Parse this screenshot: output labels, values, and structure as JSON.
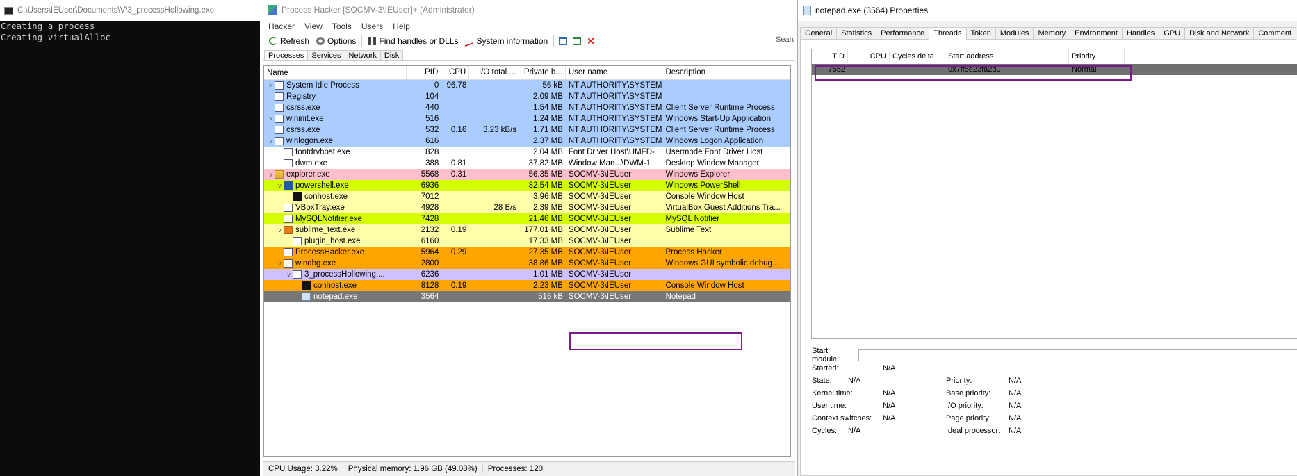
{
  "console": {
    "title": "C:\\Users\\IEUser\\Documents\\V\\3_processHollowing.exe",
    "lines": [
      "Creating a process",
      "Creating virtualAlloc"
    ]
  },
  "process_hacker": {
    "title": "Process Hacker [SOCMV-3\\IEUser]+ (Administrator)",
    "menu": [
      "Hacker",
      "View",
      "Tools",
      "Users",
      "Help"
    ],
    "toolbar": {
      "refresh": "Refresh",
      "options": "Options",
      "find_handles": "Find handles or DLLs",
      "system_info": "System information",
      "search_placeholder": "Search"
    },
    "tabs": [
      "Processes",
      "Services",
      "Network",
      "Disk"
    ],
    "columns": [
      "Name",
      "PID",
      "CPU",
      "I/O total ...",
      "Private b...",
      "User name",
      "Description"
    ],
    "processes": [
      {
        "indent": 0,
        "exp": ">",
        "icon": "window-icon",
        "name": "System Idle Process",
        "pid": "0",
        "cpu": "96.78",
        "io": "",
        "priv": "56 kB",
        "user": "NT AUTHORITY\\SYSTEM",
        "desc": "",
        "bg": "#aaccff"
      },
      {
        "indent": 0,
        "exp": "",
        "icon": "window-icon",
        "name": "Registry",
        "pid": "104",
        "cpu": "",
        "io": "",
        "priv": "2.09 MB",
        "user": "NT AUTHORITY\\SYSTEM",
        "desc": "",
        "bg": "#aaccff"
      },
      {
        "indent": 0,
        "exp": "",
        "icon": "window-icon",
        "name": "csrss.exe",
        "pid": "440",
        "cpu": "",
        "io": "",
        "priv": "1.54 MB",
        "user": "NT AUTHORITY\\SYSTEM",
        "desc": "Client Server Runtime Process",
        "bg": "#aaccff"
      },
      {
        "indent": 0,
        "exp": ">",
        "icon": "window-icon",
        "name": "wininit.exe",
        "pid": "516",
        "cpu": "",
        "io": "",
        "priv": "1.24 MB",
        "user": "NT AUTHORITY\\SYSTEM",
        "desc": "Windows Start-Up Application",
        "bg": "#aaccff"
      },
      {
        "indent": 0,
        "exp": "",
        "icon": "window-icon",
        "name": "csrss.exe",
        "pid": "532",
        "cpu": "0.16",
        "io": "3.23 kB/s",
        "priv": "1.71 MB",
        "user": "NT AUTHORITY\\SYSTEM",
        "desc": "Client Server Runtime Process",
        "bg": "#aaccff"
      },
      {
        "indent": 0,
        "exp": "v",
        "icon": "window-icon",
        "name": "winlogon.exe",
        "pid": "616",
        "cpu": "",
        "io": "",
        "priv": "2.37 MB",
        "user": "NT AUTHORITY\\SYSTEM",
        "desc": "Windows Logon Application",
        "bg": "#aaccff"
      },
      {
        "indent": 1,
        "exp": "",
        "icon": "window-icon",
        "name": "fontdrvhost.exe",
        "pid": "828",
        "cpu": "",
        "io": "",
        "priv": "2.04 MB",
        "user": "Font Driver Host\\UMFD-",
        "desc": "Usermode Font Driver Host",
        "bg": "#ffffff"
      },
      {
        "indent": 1,
        "exp": "",
        "icon": "window-icon",
        "name": "dwm.exe",
        "pid": "388",
        "cpu": "0.81",
        "io": "",
        "priv": "37.82 MB",
        "user": "Window Man...\\DWM-1",
        "desc": "Desktop Window Manager",
        "bg": "#ffffff"
      },
      {
        "indent": 0,
        "exp": "v",
        "icon": "explorer-icon",
        "name": "explorer.exe",
        "pid": "5568",
        "cpu": "0.31",
        "io": "",
        "priv": "56.35 MB",
        "user": "SOCMV-3\\IEUser",
        "desc": "Windows Explorer",
        "bg": "#ffc0cb"
      },
      {
        "indent": 1,
        "exp": "v",
        "icon": "powershell-icon",
        "name": "powershell.exe",
        "pid": "6936",
        "cpu": "",
        "io": "",
        "priv": "82.54 MB",
        "user": "SOCMV-3\\IEUser",
        "desc": "Windows PowerShell",
        "bg": "#d4ff00"
      },
      {
        "indent": 2,
        "exp": "",
        "icon": "console-icon",
        "name": "conhost.exe",
        "pid": "7012",
        "cpu": "",
        "io": "",
        "priv": "3.96 MB",
        "user": "SOCMV-3\\IEUser",
        "desc": "Console Window Host",
        "bg": "#ffffaa"
      },
      {
        "indent": 1,
        "exp": "",
        "icon": "vbox-icon",
        "name": "VBoxTray.exe",
        "pid": "4928",
        "cpu": "",
        "io": "28 B/s",
        "priv": "2.39 MB",
        "user": "SOCMV-3\\IEUser",
        "desc": "VirtualBox Guest Additions Tra...",
        "bg": "#ffffaa"
      },
      {
        "indent": 1,
        "exp": "",
        "icon": "mysql-icon",
        "name": "MySQLNotifier.exe",
        "pid": "7428",
        "cpu": "",
        "io": "",
        "priv": "21.46 MB",
        "user": "SOCMV-3\\IEUser",
        "desc": "MySQL Notifier",
        "bg": "#d4ff00"
      },
      {
        "indent": 1,
        "exp": "v",
        "icon": "sublime-icon",
        "name": "sublime_text.exe",
        "pid": "2132",
        "cpu": "0.19",
        "io": "",
        "priv": "177.01 MB",
        "user": "SOCMV-3\\IEUser",
        "desc": "Sublime Text",
        "bg": "#ffffaa"
      },
      {
        "indent": 2,
        "exp": "",
        "icon": "window-icon",
        "name": "plugin_host.exe",
        "pid": "6160",
        "cpu": "",
        "io": "",
        "priv": "17.33 MB",
        "user": "SOCMV-3\\IEUser",
        "desc": "",
        "bg": "#ffffaa"
      },
      {
        "indent": 1,
        "exp": "",
        "icon": "processhacker-icon",
        "name": "ProcessHacker.exe",
        "pid": "5964",
        "cpu": "0.29",
        "io": "",
        "priv": "27.35 MB",
        "user": "SOCMV-3\\IEUser",
        "desc": "Process Hacker",
        "bg": "#ffa500"
      },
      {
        "indent": 1,
        "exp": "v",
        "icon": "windbg-icon",
        "name": "windbg.exe",
        "pid": "2800",
        "cpu": "",
        "io": "",
        "priv": "38.86 MB",
        "user": "SOCMV-3\\IEUser",
        "desc": "Windows GUI symbolic debug...",
        "bg": "#ffa500"
      },
      {
        "indent": 2,
        "exp": "v",
        "icon": "window-icon",
        "name": "3_processHollowing....",
        "pid": "6236",
        "cpu": "",
        "io": "",
        "priv": "1.01 MB",
        "user": "SOCMV-3\\IEUser",
        "desc": "",
        "bg": "#d0c0ff"
      },
      {
        "indent": 3,
        "exp": "",
        "icon": "console-icon",
        "name": "conhost.exe",
        "pid": "8128",
        "cpu": "0.19",
        "io": "",
        "priv": "2.23 MB",
        "user": "SOCMV-3\\IEUser",
        "desc": "Console Window Host",
        "bg": "#ffa500"
      },
      {
        "indent": 3,
        "exp": "",
        "icon": "notepad-icon",
        "name": "notepad.exe",
        "pid": "3564",
        "cpu": "",
        "io": "",
        "priv": "516 kB",
        "user": "SOCMV-3\\IEUser",
        "desc": "Notepad",
        "bg": "#777777"
      }
    ],
    "status": {
      "cpu": "CPU Usage: 3.22%",
      "memory": "Physical memory: 1.96 GB (49.08%)",
      "processes": "Processes: 120"
    }
  },
  "properties": {
    "title": "notepad.exe (3564) Properties",
    "tabs": [
      "General",
      "Statistics",
      "Performance",
      "Threads",
      "Token",
      "Modules",
      "Memory",
      "Environment",
      "Handles",
      "GPU",
      "Disk and Network",
      "Comment"
    ],
    "active_tab": "Threads",
    "columns": [
      "TID",
      "CPU",
      "Cycles delta",
      "Start address",
      "Priority"
    ],
    "threads": [
      {
        "tid": "7552",
        "cpu": "",
        "cycles": "",
        "start": "0x7ff8e23fa2d0",
        "priority": "Normal"
      }
    ],
    "start_module_label": "Start module:",
    "left_fields": [
      {
        "label": "Started:",
        "value": "N/A"
      },
      {
        "label": "State:",
        "value": "N/A"
      },
      {
        "label": "Kernel time:",
        "value": "N/A"
      },
      {
        "label": "User time:",
        "value": "N/A"
      },
      {
        "label": "Context switches:",
        "value": "N/A"
      },
      {
        "label": "Cycles:",
        "value": "N/A"
      }
    ],
    "right_fields": [
      {
        "label": "Priority:",
        "value": "N/A"
      },
      {
        "label": "Base priority:",
        "value": "N/A"
      },
      {
        "label": "I/O priority:",
        "value": "N/A"
      },
      {
        "label": "Page priority:",
        "value": "N/A"
      },
      {
        "label": "Ideal processor:",
        "value": "N/A"
      }
    ]
  }
}
